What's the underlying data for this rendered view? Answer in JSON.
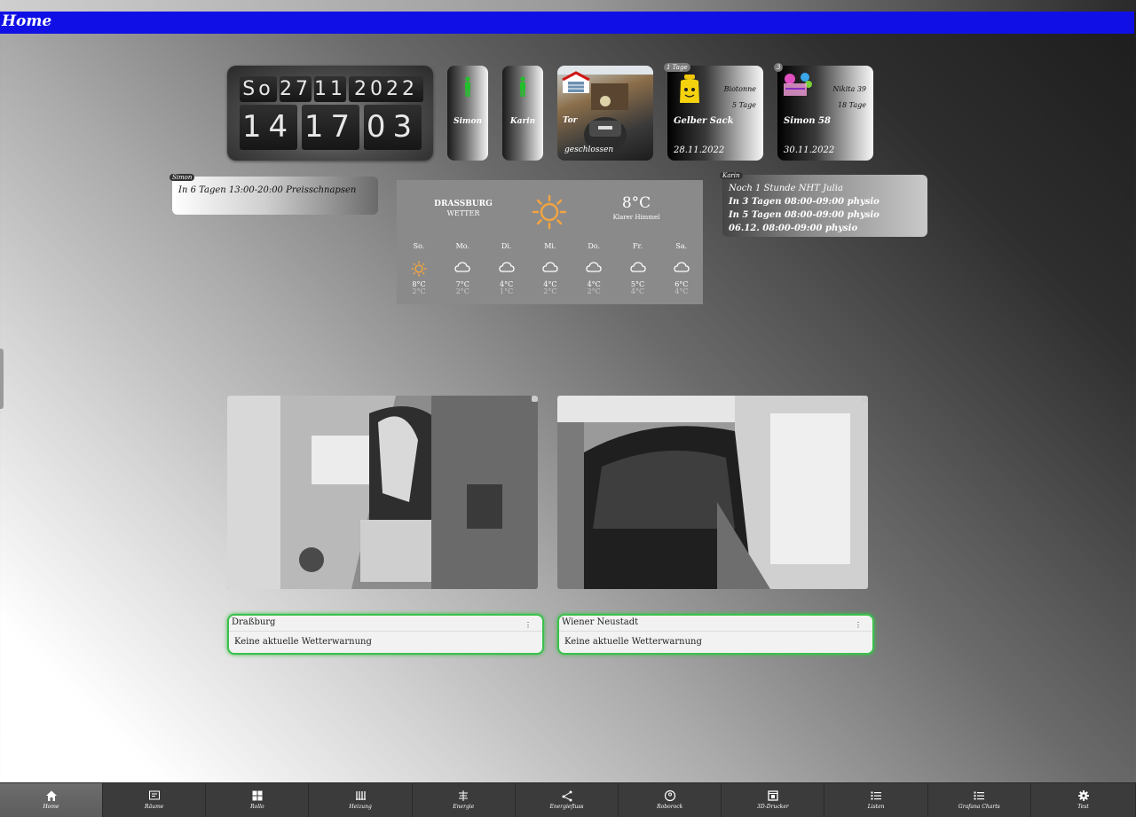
{
  "header": {
    "title": "Home"
  },
  "clock": {
    "weekday": "So",
    "day": "27",
    "month": "11",
    "year": "2022",
    "hour": "14",
    "minute": "17",
    "second": "03"
  },
  "presence": [
    {
      "name": "Simon",
      "color": "#22c02a"
    },
    {
      "name": "Karin",
      "color": "#22c02a"
    }
  ],
  "garage": {
    "label": "Tor",
    "status": "geschlossen"
  },
  "events": [
    {
      "badge": "1 Tage",
      "info1": "Biotonne",
      "info2": "5 Tage",
      "title": "Gelber Sack",
      "date": "28.11.2022"
    },
    {
      "badge": "3",
      "info1": "Nikita 39",
      "info2": "18 Tage",
      "title": "Simon 58",
      "date": "30.11.2022"
    }
  ],
  "calendar_simon": {
    "tag": "Simon",
    "lines": [
      "In 6 Tagen 13:00-20:00 Preisschnapsen"
    ]
  },
  "calendar_karin": {
    "tag": "Karin",
    "lines": [
      "Noch 1 Stunde NHT Julia",
      "In 3 Tagen 08:00-09:00 physio",
      "In 5 Tagen 08:00-09:00 physio",
      "06.12. 08:00-09:00 physio"
    ]
  },
  "weather": {
    "city": "DRASSBURG",
    "label": "WETTER",
    "temp": "8°C",
    "desc": "Klarer Himmel",
    "days": [
      {
        "d": "So.",
        "icon": "sun-icon",
        "hi": "8°C",
        "lo": "2°C"
      },
      {
        "d": "Mo.",
        "icon": "cloud-icon",
        "hi": "7°C",
        "lo": "2°C"
      },
      {
        "d": "Di.",
        "icon": "cloud-icon",
        "hi": "4°C",
        "lo": "1°C"
      },
      {
        "d": "Mi.",
        "icon": "cloud-icon",
        "hi": "4°C",
        "lo": "2°C"
      },
      {
        "d": "Do.",
        "icon": "cloud-icon",
        "hi": "4°C",
        "lo": "2°C"
      },
      {
        "d": "Fr.",
        "icon": "cloud-icon",
        "hi": "5°C",
        "lo": "4°C"
      },
      {
        "d": "Sa.",
        "icon": "cloud-icon",
        "hi": "6°C",
        "lo": "4°C"
      }
    ]
  },
  "warnings": [
    {
      "location": "Draßburg",
      "text": "Keine aktuelle Wetterwarnung"
    },
    {
      "location": "Wiener Neustadt",
      "text": "Keine aktuelle Wetterwarnung"
    }
  ],
  "nav": [
    {
      "label": "Home",
      "icon": "home-icon"
    },
    {
      "label": "Räume",
      "icon": "rooms-icon"
    },
    {
      "label": "Rollo",
      "icon": "shutter-icon"
    },
    {
      "label": "Heizung",
      "icon": "heating-icon"
    },
    {
      "label": "Energie",
      "icon": "energy-icon"
    },
    {
      "label": "Energiefluss",
      "icon": "energy-flow-icon"
    },
    {
      "label": "Roborock",
      "icon": "robot-vacuum-icon"
    },
    {
      "label": "3D-Drucker",
      "icon": "printer-icon"
    },
    {
      "label": "Listen",
      "icon": "list-icon"
    },
    {
      "label": "Grafana Charts",
      "icon": "list-icon"
    },
    {
      "label": "Test",
      "icon": "gear-icon"
    }
  ]
}
